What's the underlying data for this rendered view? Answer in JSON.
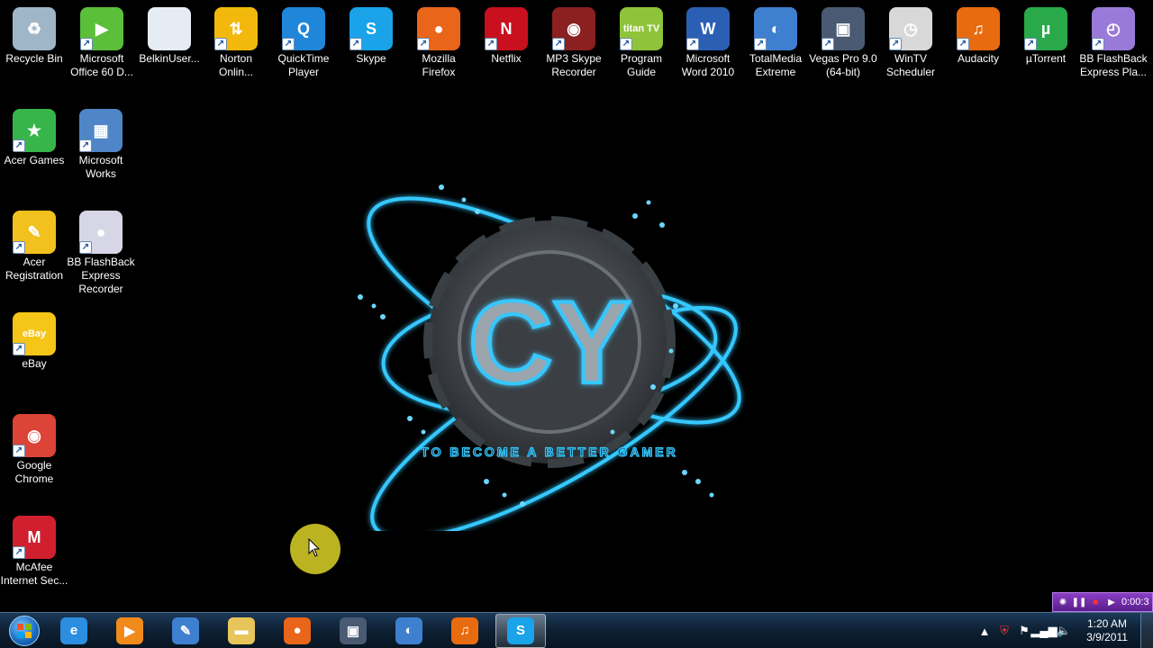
{
  "desktop_icons": [
    {
      "label": "Recycle Bin",
      "icon": "recycle-bin-icon",
      "color": "#9fb6c9",
      "glyph": "♻",
      "shortcut": false
    },
    {
      "label": "Microsoft Office 60 D...",
      "icon": "office-trial-icon",
      "color": "#5bbf3a",
      "glyph": "▶",
      "shortcut": true
    },
    {
      "label": "BelkinUser...",
      "icon": "document-icon",
      "color": "#e6ecf4",
      "glyph": "",
      "shortcut": false
    },
    {
      "label": "Norton Onlin...",
      "icon": "norton-icon",
      "color": "#f2b90c",
      "glyph": "⇅",
      "shortcut": true
    },
    {
      "label": "QuickTime Player",
      "icon": "quicktime-icon",
      "color": "#1f86d9",
      "glyph": "Q",
      "shortcut": true
    },
    {
      "label": "Skype",
      "icon": "skype-icon",
      "color": "#1aa3e8",
      "glyph": "S",
      "shortcut": true
    },
    {
      "label": "Mozilla Firefox",
      "icon": "firefox-icon",
      "color": "#e8651a",
      "glyph": "●",
      "shortcut": true
    },
    {
      "label": "Netflix",
      "icon": "netflix-icon",
      "color": "#c8101e",
      "glyph": "N",
      "shortcut": true
    },
    {
      "label": "MP3 Skype Recorder",
      "icon": "mp3-skype-recorder-icon",
      "color": "#8a2020",
      "glyph": "◉",
      "shortcut": true
    },
    {
      "label": "Program Guide",
      "icon": "titantv-icon",
      "color": "#8fc43a",
      "glyph": "titan TV",
      "shortcut": true
    },
    {
      "label": "Microsoft Word 2010",
      "icon": "word-icon",
      "color": "#2b5fb4",
      "glyph": "W",
      "shortcut": true
    },
    {
      "label": "TotalMedia Extreme",
      "icon": "totalmedia-icon",
      "color": "#3f7fcf",
      "glyph": "◐",
      "shortcut": true
    },
    {
      "label": "Vegas Pro 9.0 (64-bit)",
      "icon": "vegas-pro-icon",
      "color": "#4a5a72",
      "glyph": "▣",
      "shortcut": true
    },
    {
      "label": "WinTV Scheduler",
      "icon": "wintv-scheduler-icon",
      "color": "#d8d8d8",
      "glyph": "◷",
      "shortcut": true
    },
    {
      "label": "Audacity",
      "icon": "audacity-icon",
      "color": "#e86b10",
      "glyph": "♫",
      "shortcut": true
    },
    {
      "label": "µTorrent",
      "icon": "utorrent-icon",
      "color": "#2aa94a",
      "glyph": "µ",
      "shortcut": true
    },
    {
      "label": "BB FlashBack Express Pla...",
      "icon": "bb-flashback-player-icon",
      "color": "#9a7ad8",
      "glyph": "◴",
      "shortcut": true
    },
    {
      "label": "Acer Games",
      "icon": "acer-games-icon",
      "color": "#38b54a",
      "glyph": "★",
      "shortcut": true
    },
    {
      "label": "Microsoft Works",
      "icon": "microsoft-works-icon",
      "color": "#4f86c8",
      "glyph": "▦",
      "shortcut": true
    },
    {
      "label": "Acer Registration",
      "icon": "acer-registration-icon",
      "color": "#f3c11d",
      "glyph": "✎",
      "shortcut": true
    },
    {
      "label": "BB FlashBack Express Recorder",
      "icon": "bb-flashback-recorder-icon",
      "color": "#d6d6e6",
      "glyph": "●",
      "shortcut": true
    },
    {
      "label": "eBay",
      "icon": "ebay-icon",
      "color": "#f5c518",
      "glyph": "eBay",
      "shortcut": true
    },
    {
      "label": "Google Chrome",
      "icon": "chrome-icon",
      "color": "#db4437",
      "glyph": "◉",
      "shortcut": true
    },
    {
      "label": "McAfee Internet Sec...",
      "icon": "mcafee-icon",
      "color": "#d02030",
      "glyph": "M",
      "shortcut": true
    }
  ],
  "wallpaper": {
    "logo_text": "CY",
    "tagline": "TO BECOME A BETTER GAMER",
    "glow_color": "#35c8ff"
  },
  "recorder": {
    "time": "0:00:3"
  },
  "taskbar": {
    "pinned": [
      {
        "name": "internet-explorer",
        "icon": "internet-explorer-icon",
        "color": "#2b8ee0",
        "glyph": "e",
        "active": false
      },
      {
        "name": "media-player",
        "icon": "media-player-icon",
        "color": "#f08a1a",
        "glyph": "▶",
        "active": false
      },
      {
        "name": "acer-utility",
        "icon": "acer-utility-icon",
        "color": "#3f7fcf",
        "glyph": "✎",
        "active": false
      },
      {
        "name": "windows-explorer",
        "icon": "folder-icon",
        "color": "#e8c55a",
        "glyph": "▬",
        "active": false
      },
      {
        "name": "firefox",
        "icon": "firefox-icon",
        "color": "#e8651a",
        "glyph": "●",
        "active": false
      },
      {
        "name": "vegas-pro",
        "icon": "vegas-pro-icon",
        "color": "#4a5a72",
        "glyph": "▣",
        "active": false
      },
      {
        "name": "totalmedia",
        "icon": "totalmedia-icon",
        "color": "#3f7fcf",
        "glyph": "◐",
        "active": false
      },
      {
        "name": "audacity",
        "icon": "audacity-icon",
        "color": "#e86b10",
        "glyph": "♫",
        "active": false
      },
      {
        "name": "skype",
        "icon": "skype-icon",
        "color": "#1aa3e8",
        "glyph": "S",
        "active": true
      }
    ],
    "tray": {
      "time": "1:20 AM",
      "date": "3/9/2011"
    }
  }
}
